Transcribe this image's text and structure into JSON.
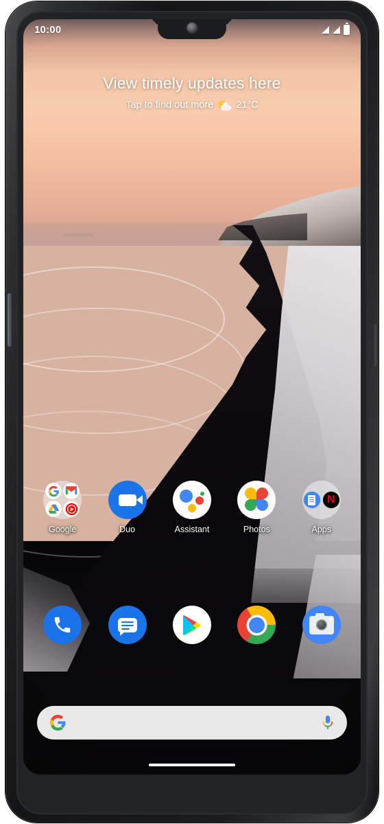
{
  "status_bar": {
    "time": "10:00",
    "icons": [
      {
        "name": "signal-bars-1-icon",
        "type": "signal"
      },
      {
        "name": "signal-bars-2-icon",
        "type": "signal"
      },
      {
        "name": "battery-icon",
        "type": "battery"
      }
    ]
  },
  "glance_widget": {
    "title": "View timely updates here",
    "subtitle": "Tap to find out more",
    "weather_icon": "partly-cloudy-icon",
    "temperature": "21°C"
  },
  "app_row": [
    {
      "label": "Google",
      "icon": "google-folder-icon",
      "type": "folder",
      "contents": [
        "google-g-icon",
        "gmail-icon",
        "drive-icon",
        "youtube-music-icon"
      ]
    },
    {
      "label": "Duo",
      "icon": "duo-icon",
      "type": "app"
    },
    {
      "label": "Assistant",
      "icon": "assistant-icon",
      "type": "app"
    },
    {
      "label": "Photos",
      "icon": "photos-icon",
      "type": "app"
    },
    {
      "label": "Apps",
      "icon": "apps-folder-icon",
      "type": "folder",
      "contents": [
        "docs-app-icon",
        "netflix-icon"
      ]
    }
  ],
  "dock": [
    {
      "label": "Phone",
      "icon": "phone-icon"
    },
    {
      "label": "Messages",
      "icon": "messages-icon"
    },
    {
      "label": "Play Store",
      "icon": "play-store-icon"
    },
    {
      "label": "Chrome",
      "icon": "chrome-icon"
    },
    {
      "label": "Camera",
      "icon": "camera-icon"
    }
  ],
  "search_bar": {
    "value": "",
    "placeholder": "",
    "left_icon": "google-g-icon",
    "right_icon": "microphone-icon"
  },
  "navigation": {
    "pill": "gesture-home-pill"
  },
  "colors": {
    "google_blue": "#4285f4",
    "google_red": "#ea4335",
    "google_yellow": "#fbbc05",
    "google_green": "#34a853",
    "android_accent_blue": "#1a73e8",
    "netflix_red": "#e50914",
    "search_bar_bg": "#e8e8e8"
  }
}
